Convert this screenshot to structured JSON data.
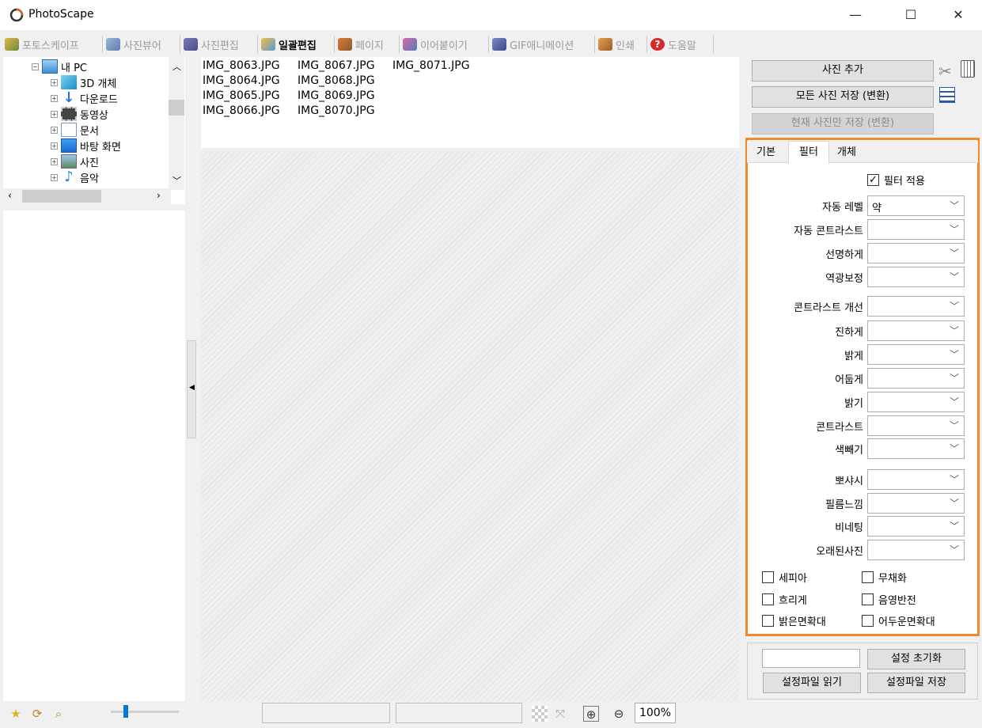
{
  "window": {
    "title": "PhotoScape",
    "minimize": "—",
    "maximize": "☐",
    "close": "✕"
  },
  "tabs": [
    {
      "label": "포토스케이프",
      "icon": "photoscape-icon",
      "active": false
    },
    {
      "label": "사진뷰어",
      "icon": "viewer-icon",
      "active": false
    },
    {
      "label": "사진편집",
      "icon": "editor-icon",
      "active": false
    },
    {
      "label": "일괄편집",
      "icon": "batch-editor-icon",
      "active": true
    },
    {
      "label": "페이지",
      "icon": "page-icon",
      "active": false
    },
    {
      "label": "이어붙이기",
      "icon": "combine-icon",
      "active": false
    },
    {
      "label": "GIF애니메이션",
      "icon": "gif-icon",
      "active": false
    },
    {
      "label": "인쇄",
      "icon": "print-icon",
      "active": false
    },
    {
      "label": "도움말",
      "icon": "help-icon",
      "active": false
    }
  ],
  "tree": {
    "root": "내 PC",
    "items": [
      {
        "label": "3D 개체",
        "icon": "3d-objects-icon"
      },
      {
        "label": "다운로드",
        "icon": "download-icon"
      },
      {
        "label": "동영상",
        "icon": "video-icon"
      },
      {
        "label": "문서",
        "icon": "document-icon"
      },
      {
        "label": "바탕 화면",
        "icon": "desktop-icon"
      },
      {
        "label": "사진",
        "icon": "pictures-icon"
      },
      {
        "label": "음악",
        "icon": "music-icon"
      }
    ]
  },
  "files": [
    [
      "IMG_8063.JPG",
      "IMG_8064.JPG",
      "IMG_8065.JPG",
      "IMG_8066.JPG"
    ],
    [
      "IMG_8067.JPG",
      "IMG_8068.JPG",
      "IMG_8069.JPG",
      "IMG_8070.JPG"
    ],
    [
      "IMG_8071.JPG"
    ]
  ],
  "right": {
    "add_photo": "사진 추가",
    "save_all": "모든 사진 저장 (변환)",
    "save_current": "현재 사진만 저장 (변환)",
    "subtabs": [
      "기본",
      "필터",
      "개체"
    ],
    "active_subtab": 1,
    "apply_filter": "필터 적용",
    "filters": [
      {
        "label": "자동 레벨",
        "value": "약"
      },
      {
        "label": "자동 콘트라스트",
        "value": ""
      },
      {
        "label": "선명하게",
        "value": ""
      },
      {
        "label": "역광보정",
        "value": ""
      },
      {
        "label": "콘트라스트 개선",
        "value": ""
      },
      {
        "label": "진하게",
        "value": ""
      },
      {
        "label": "밝게",
        "value": ""
      },
      {
        "label": "어둡게",
        "value": ""
      },
      {
        "label": "밝기",
        "value": ""
      },
      {
        "label": "콘트라스트",
        "value": ""
      },
      {
        "label": "색빼기",
        "value": ""
      },
      {
        "label": "뽀샤시",
        "value": ""
      },
      {
        "label": "필름느낌",
        "value": ""
      },
      {
        "label": "비네팅",
        "value": ""
      },
      {
        "label": "오래된사진",
        "value": ""
      }
    ],
    "checkboxes": [
      {
        "label": "세피아",
        "checked": false
      },
      {
        "label": "무채화",
        "checked": false
      },
      {
        "label": "흐리게",
        "checked": false
      },
      {
        "label": "음영반전",
        "checked": false
      },
      {
        "label": "밝은면확대",
        "checked": false
      },
      {
        "label": "어두운면확대",
        "checked": false
      }
    ],
    "reset": "설정 초기화",
    "load_settings": "설정파일 읽기",
    "save_settings": "설정파일 저장"
  },
  "status": {
    "zoom": "100%"
  },
  "colors": {
    "highlight_border": "#f28a2a"
  }
}
